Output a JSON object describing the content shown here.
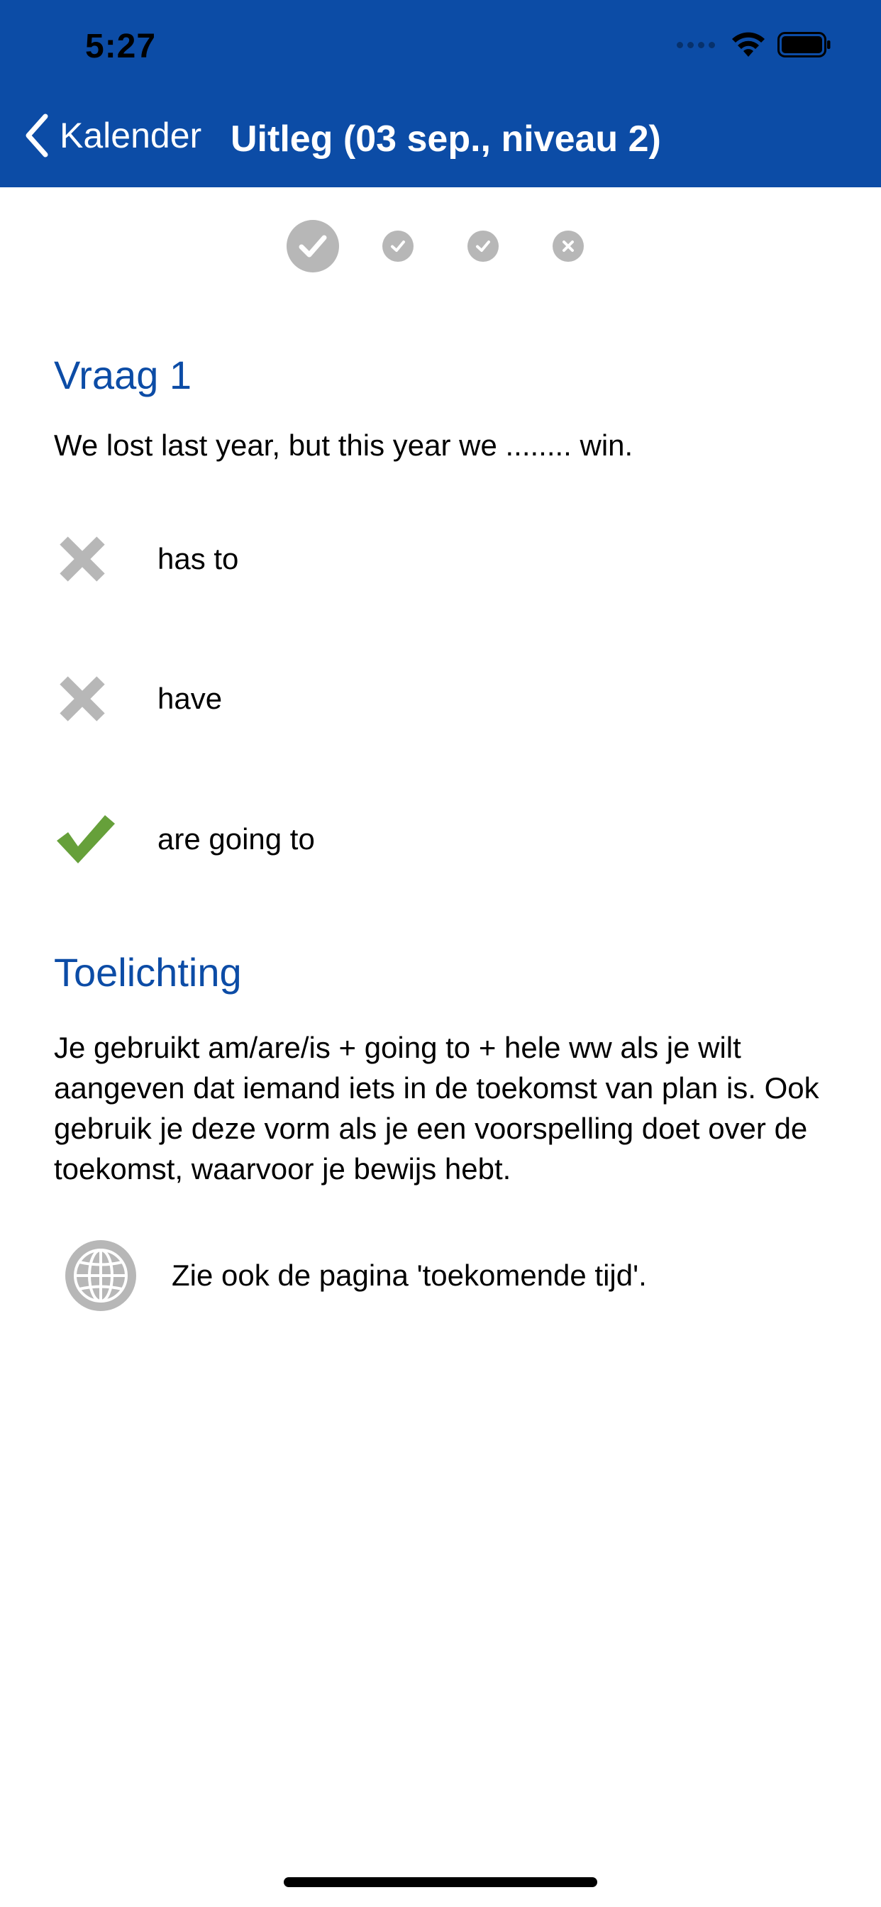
{
  "status_bar": {
    "time": "5:27"
  },
  "nav": {
    "back_label": "Kalender",
    "title": "Uitleg (03 sep., niveau 2)"
  },
  "progress": {
    "items": [
      {
        "state": "correct",
        "current": true
      },
      {
        "state": "correct",
        "current": false
      },
      {
        "state": "correct",
        "current": false
      },
      {
        "state": "wrong",
        "current": false
      }
    ]
  },
  "question": {
    "heading": "Vraag 1",
    "text": "We lost last year, but this year we ........ win.",
    "options": [
      {
        "label": "has to",
        "result": "wrong",
        "icon": "cross-icon"
      },
      {
        "label": "have",
        "result": "wrong",
        "icon": "cross-icon"
      },
      {
        "label": "are going to",
        "result": "correct",
        "icon": "checkmark-icon"
      }
    ]
  },
  "explanation": {
    "heading": "Toelichting",
    "text": "Je gebruikt am/are/is + going to + hele ww als je wilt aangeven dat iemand iets in de toekomst van plan is. Ook gebruik je deze vorm als je een voorspelling doet over de toekomst, waarvoor je bewijs hebt.",
    "link_label": "Zie ook de pagina 'toekomende tijd'.",
    "link_icon": "globe-icon"
  },
  "colors": {
    "header": "#0c4ca6",
    "heading": "#0c4ca6",
    "correct": "#66a03a",
    "neutral_icon": "#b7b7b7"
  }
}
